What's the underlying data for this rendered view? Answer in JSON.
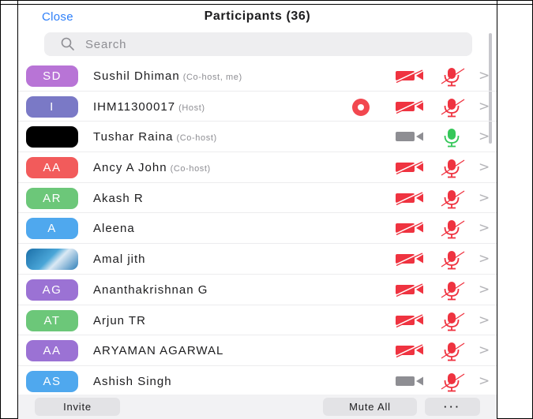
{
  "header": {
    "close_label": "Close",
    "title": "Participants (36)"
  },
  "search": {
    "placeholder": "Search"
  },
  "colors": {
    "accent": "#2d7ff9",
    "muted_red": "#ef3340",
    "active_green": "#35c759",
    "off_gray": "#8e8e93"
  },
  "participants": [
    {
      "initials": "SD",
      "avatar_color": "#b874d6",
      "avatar_type": "initials",
      "name": "Sushil Dhiman",
      "role": "(Co-host, me)",
      "recording": false,
      "video_on": false,
      "mic_on": false
    },
    {
      "initials": "I",
      "avatar_color": "#7a79c6",
      "avatar_type": "initials",
      "name": "IHM11300017",
      "role": "(Host)",
      "recording": true,
      "video_on": false,
      "mic_on": false
    },
    {
      "initials": "",
      "avatar_color": "#000000",
      "avatar_type": "black",
      "name": "Tushar Raina",
      "role": "(Co-host)",
      "recording": false,
      "video_on": true,
      "mic_on": true
    },
    {
      "initials": "AA",
      "avatar_color": "#f25b5b",
      "avatar_type": "initials",
      "name": "Ancy A John",
      "role": "(Co-host)",
      "recording": false,
      "video_on": false,
      "mic_on": false
    },
    {
      "initials": "AR",
      "avatar_color": "#6cc779",
      "avatar_type": "initials",
      "name": "Akash R",
      "role": "",
      "recording": false,
      "video_on": false,
      "mic_on": false
    },
    {
      "initials": "A",
      "avatar_color": "#4fa8ee",
      "avatar_type": "initials",
      "name": "Aleena",
      "role": "",
      "recording": false,
      "video_on": false,
      "mic_on": false
    },
    {
      "initials": "",
      "avatar_color": "#2f7fb8",
      "avatar_type": "image",
      "name": "Amal jith",
      "role": "",
      "recording": false,
      "video_on": false,
      "mic_on": false
    },
    {
      "initials": "AG",
      "avatar_color": "#9b72d4",
      "avatar_type": "initials",
      "name": "Ananthakrishnan G",
      "role": "",
      "recording": false,
      "video_on": false,
      "mic_on": false
    },
    {
      "initials": "AT",
      "avatar_color": "#6cc779",
      "avatar_type": "initials",
      "name": "Arjun TR",
      "role": "",
      "recording": false,
      "video_on": false,
      "mic_on": false
    },
    {
      "initials": "AA",
      "avatar_color": "#9b72d4",
      "avatar_type": "initials",
      "name": "ARYAMAN AGARWAL",
      "role": "",
      "recording": false,
      "video_on": false,
      "mic_on": false
    },
    {
      "initials": "AS",
      "avatar_color": "#4fa8ee",
      "avatar_type": "initials",
      "name": "Ashish Singh",
      "role": "",
      "recording": false,
      "video_on": true,
      "mic_on": false
    }
  ],
  "footer": {
    "invite_label": "Invite",
    "mute_all_label": "Mute All",
    "more_label": "···"
  }
}
